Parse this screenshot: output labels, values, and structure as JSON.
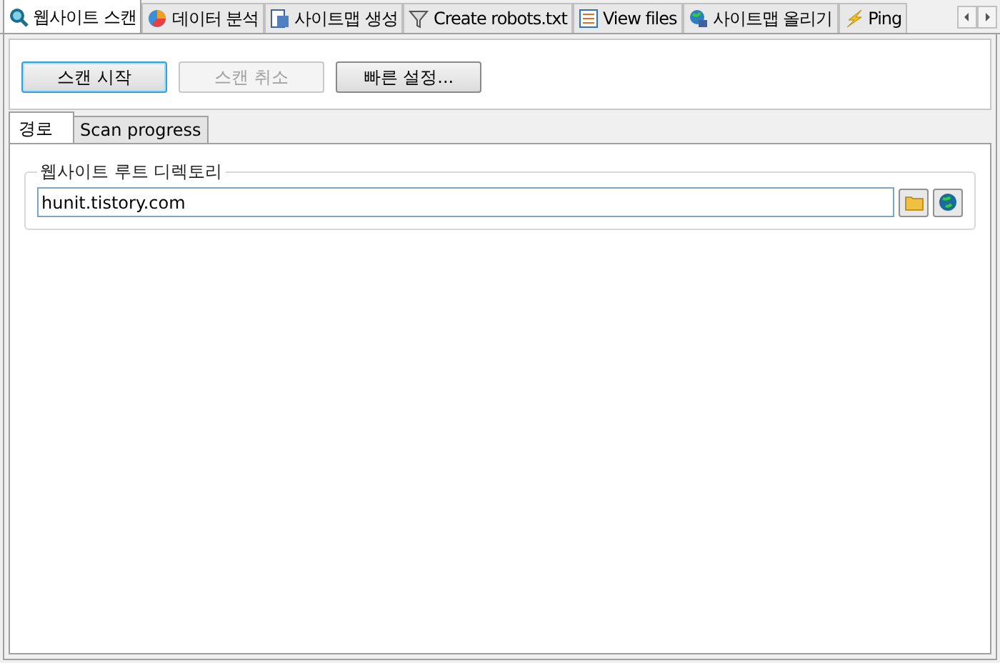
{
  "main_tabs": [
    {
      "label": "웹사이트 스캔",
      "kind": "search",
      "selected": true
    },
    {
      "label": "데이터 분석",
      "kind": "pie",
      "selected": false
    },
    {
      "label": "사이트맵 생성",
      "kind": "sitemap",
      "selected": false
    },
    {
      "label": "Create robots.txt",
      "kind": "filter",
      "selected": false
    },
    {
      "label": "View files",
      "kind": "list",
      "selected": false
    },
    {
      "label": "사이트맵 올리기",
      "kind": "globe",
      "selected": false
    },
    {
      "label": "Ping",
      "kind": "bolt",
      "selected": false
    }
  ],
  "toolbar": [
    {
      "label": "스캔 시작",
      "default": true,
      "disabled": false
    },
    {
      "label": "스캔 취소",
      "default": false,
      "disabled": true
    },
    {
      "label": "빠른 설정...",
      "default": false,
      "disabled": false
    }
  ],
  "sub_tabs": [
    {
      "label": "경로",
      "selected": true
    },
    {
      "label": "Scan progress",
      "selected": false
    }
  ],
  "root_group": {
    "title": "웹사이트 루트 디렉토리",
    "value": "hunit.tistory.com"
  }
}
